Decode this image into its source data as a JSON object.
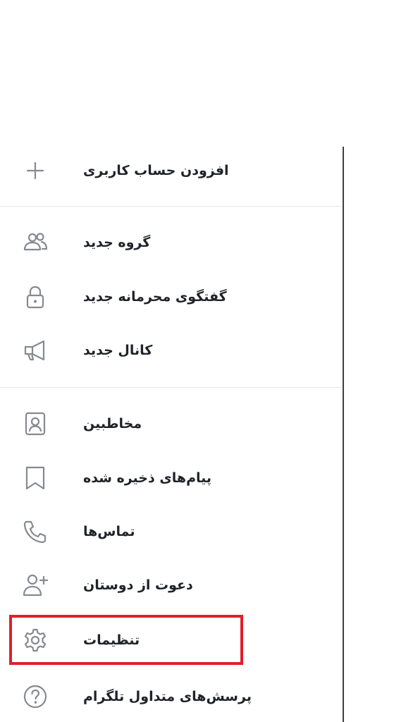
{
  "menu": {
    "add_account": {
      "label": "افزودن حساب کاربری",
      "icon": "plus-icon"
    },
    "new_group": {
      "label": "گروه جدید",
      "icon": "people-icon"
    },
    "new_secret_chat": {
      "label": "گفتگوی محرمانه جدید",
      "icon": "lock-icon"
    },
    "new_channel": {
      "label": "کانال جدید",
      "icon": "megaphone-icon"
    },
    "contacts": {
      "label": "مخاطبین",
      "icon": "contact-card-icon"
    },
    "saved_messages": {
      "label": "پیام‌های ذخیره شده",
      "icon": "bookmark-icon"
    },
    "calls": {
      "label": "تماس‌ها",
      "icon": "phone-icon"
    },
    "invite_friends": {
      "label": "دعوت از دوستان",
      "icon": "add-person-icon"
    },
    "settings": {
      "label": "تنظیمات",
      "icon": "gear-icon"
    },
    "faq": {
      "label": "پرسش‌های متداول تلگرام",
      "icon": "question-circle-icon"
    }
  },
  "colors": {
    "highlight_border": "#e0202a",
    "icon": "#858a91",
    "text": "#1f2329",
    "divider": "#e4e6e9"
  }
}
